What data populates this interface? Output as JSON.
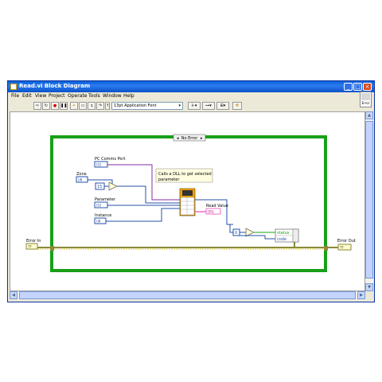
{
  "window": {
    "title": "Read.vi Block Diagram"
  },
  "menu": [
    "File",
    "Edit",
    "View",
    "Project",
    "Operate",
    "Tools",
    "Window",
    "Help"
  ],
  "toolbar": {
    "font": "13pt Application Font"
  },
  "help_label": "Error",
  "diagram": {
    "case_selector": "No Error",
    "comment": [
      "Calls a DLL to get selected",
      "parameter"
    ],
    "controls": {
      "pc_comms_port": "PC Comms Port",
      "zone": "Zone",
      "parameter": "Parameter",
      "instance": "Instance",
      "error_in": "Error In",
      "error_out": "Error Out",
      "read_value": "Read Value"
    },
    "types": {
      "i32": "I32",
      "u8": "U8",
      "dbl": "DBL",
      "err": "TF"
    },
    "constant_15": "15",
    "constant_0": "0",
    "cluster_fields": [
      "status",
      "code"
    ]
  }
}
